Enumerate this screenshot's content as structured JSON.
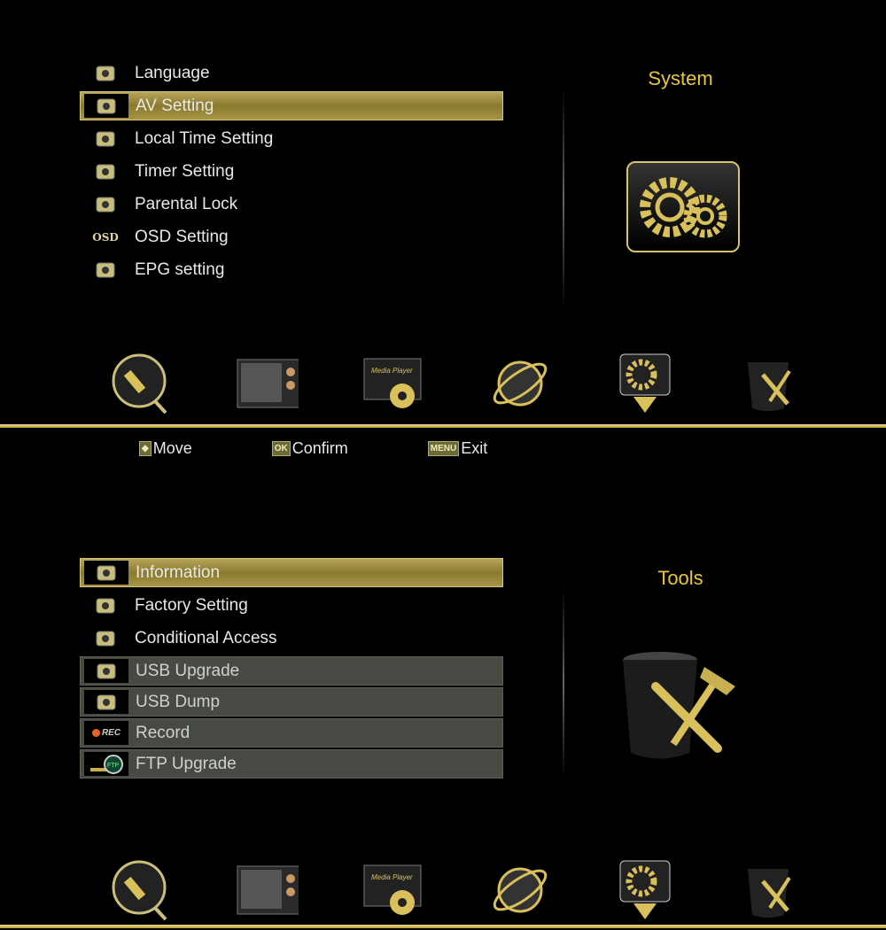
{
  "system": {
    "title": "System",
    "items": [
      {
        "label": "Language",
        "icon": "language-icon"
      },
      {
        "label": "AV Setting",
        "icon": "av-setting-icon",
        "selected": true
      },
      {
        "label": "Local Time Setting",
        "icon": "globe-clock-icon"
      },
      {
        "label": "Timer Setting",
        "icon": "timer-icon"
      },
      {
        "label": "Parental Lock",
        "icon": "parental-lock-icon"
      },
      {
        "label": "OSD Setting",
        "icon": "osd-icon",
        "icon_text": "OSD"
      },
      {
        "label": "EPG setting",
        "icon": "epg-icon"
      }
    ]
  },
  "hints": [
    {
      "key": "◆",
      "label": "Move"
    },
    {
      "key": "OK",
      "label": "Confirm"
    },
    {
      "key": "MENU",
      "label": "Exit"
    }
  ],
  "tools": {
    "title": "Tools",
    "items": [
      {
        "label": "Information",
        "icon": "information-icon",
        "selected": true
      },
      {
        "label": "Factory Setting",
        "icon": "factory-setting-icon"
      },
      {
        "label": "Conditional Access",
        "icon": "conditional-access-icon"
      },
      {
        "label": "USB Upgrade",
        "icon": "usb-upgrade-icon",
        "disabled": true
      },
      {
        "label": "USB Dump",
        "icon": "usb-dump-icon",
        "disabled": true
      },
      {
        "label": "Record",
        "icon": "record-icon",
        "icon_text": "REC",
        "disabled": true
      },
      {
        "label": "FTP Upgrade",
        "icon": "ftp-upgrade-icon",
        "icon_text": "FTP",
        "disabled": true
      }
    ]
  },
  "main_menu": {
    "items": [
      "installation-icon",
      "tv-icon",
      "media-player-icon",
      "network-icon",
      "system-icon",
      "tools-icon"
    ],
    "media_player_text": "Media Player",
    "top_active": "system",
    "bottom_active": "tools"
  },
  "colors": {
    "accent": "#e8c63c",
    "highlight": "#a69546",
    "disabled": "#464a42"
  }
}
